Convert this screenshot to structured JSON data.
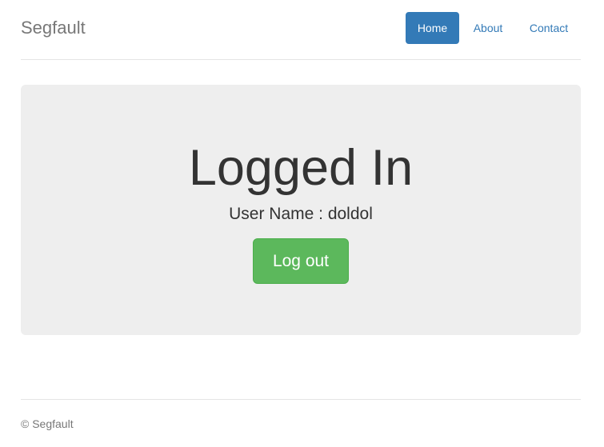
{
  "header": {
    "brand": "Segfault",
    "nav": [
      {
        "label": "Home",
        "active": true
      },
      {
        "label": "About",
        "active": false
      },
      {
        "label": "Contact",
        "active": false
      }
    ]
  },
  "main": {
    "title": "Logged In",
    "user_line": "User Name : doldol",
    "logout_label": "Log out"
  },
  "footer": {
    "text": "© Segfault"
  },
  "colors": {
    "primary": "#337ab7",
    "success": "#5cb85c",
    "jumbotron_bg": "#eeeeee",
    "muted": "#777777"
  }
}
